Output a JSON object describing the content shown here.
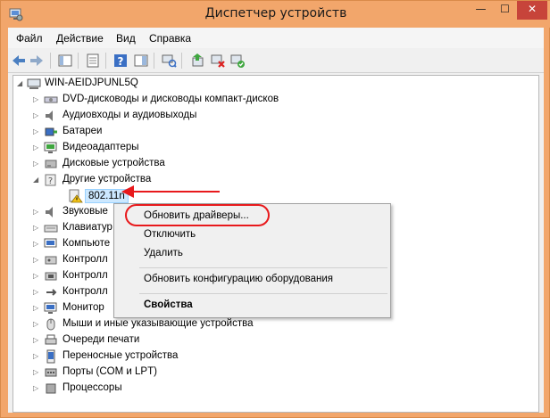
{
  "window": {
    "title": "Диспетчер устройств",
    "minimize_glyph": "—",
    "maximize_glyph": "☐",
    "close_glyph": "✕",
    "accent": "#f2a66b"
  },
  "menu": [
    "Файл",
    "Действие",
    "Вид",
    "Справка"
  ],
  "tree": {
    "root": "WIN-AEIDJPUNL5Q",
    "nodes": [
      "DVD-дисководы и дисководы компакт-дисков",
      "Аудиовходы и аудиовыходы",
      "Батареи",
      "Видеоадаптеры",
      "Дисковые устройства",
      "Другие устройства",
      "802.11n",
      "Звуковые",
      "Клавиатур",
      "Компьюте",
      "Контролл",
      "Контролл",
      "Контролл",
      "Монитор",
      "Мыши и иные указывающие устройства",
      "Очереди печати",
      "Переносные устройства",
      "Порты (COM и LPT)",
      "Процессоры"
    ]
  },
  "context_menu": {
    "update": "Обновить драйверы...",
    "disable": "Отключить",
    "delete": "Удалить",
    "scan": "Обновить конфигурацию оборудования",
    "properties": "Свойства"
  }
}
